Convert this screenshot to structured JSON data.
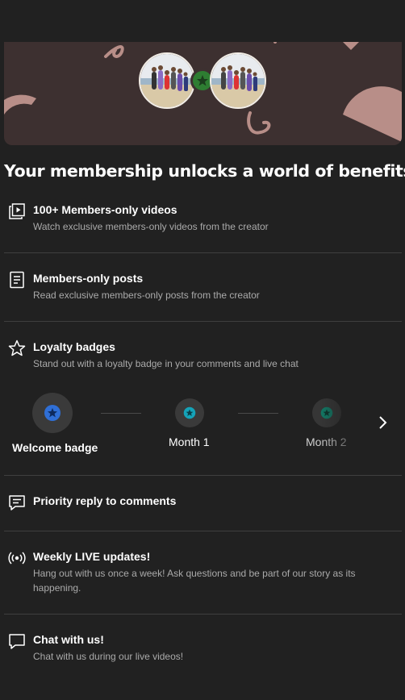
{
  "headline": "Your membership unlocks a world of benefits!",
  "benefits": [
    {
      "icon": "video-library-icon",
      "title": "100+ Members-only videos",
      "desc": "Watch exclusive members-only videos from the creator"
    },
    {
      "icon": "post-document-icon",
      "title": "Members-only posts",
      "desc": "Read exclusive members-only posts from the creator"
    },
    {
      "icon": "star-outline-icon",
      "title": "Loyalty badges",
      "desc": "Stand out with a loyalty badge in your comments and live chat"
    },
    {
      "icon": "comment-icon",
      "title": "Priority reply to comments"
    },
    {
      "icon": "live-broadcast-icon",
      "title": "Weekly LIVE updates!",
      "desc": "Hang out with us once a week! Ask questions and be part of our story as its happening."
    },
    {
      "icon": "chat-bubble-icon",
      "title": "Chat with us!",
      "desc": "Chat with us during our live videos!"
    }
  ],
  "badges": [
    {
      "label": "Welcome badge",
      "color": "#2f6fd6"
    },
    {
      "label": "Month 1",
      "color": "#15a3b8"
    },
    {
      "label": "Month 2",
      "color": "#0f8a73"
    }
  ],
  "colors": {
    "background": "#212121",
    "banner": "#3d3030",
    "banner_accent": "#b88e88",
    "badge_star": "#2e7d32"
  }
}
